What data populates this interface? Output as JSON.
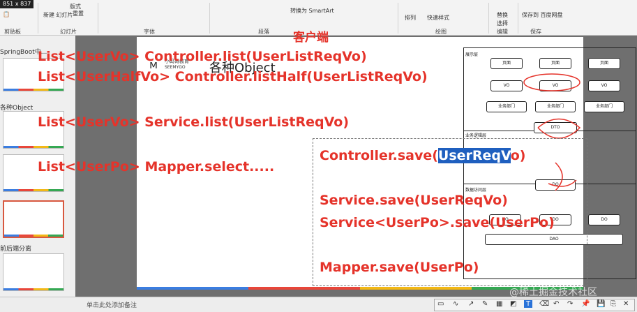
{
  "ribbon": {
    "dimension_readout": "851 x 837",
    "new_slide_label": "新建\n幻灯片",
    "reuse_label": "重置",
    "section_label": "版式",
    "groups": [
      "剪贴板",
      "幻灯片",
      "字体",
      "段落",
      "绘图",
      "编辑",
      "保存"
    ],
    "smartart_label": "转换为 SmartArt",
    "arrange_label": "排列",
    "quickstyle_label": "快速样式",
    "replace_label": "替换",
    "select_label": "选择",
    "save_cloud_label": "保存到\n百度网盘"
  },
  "thumbnails": {
    "section1": "SpringBoot中...",
    "section2": "各种Object",
    "section3": "前后端分离"
  },
  "slide": {
    "client_title": "客户端",
    "logo_name": "小码哥教育",
    "logo_sub": "SEEMYGO",
    "heading": "各种Object",
    "lines": [
      "List<UserVo> Controller.list(UserListReqVo)",
      "List<UserHalfVo> Controller.listHalf(UserListReqVo)",
      "List<UserVo> Service.list(UserListReqVo)",
      "List<UserPo> Mapper.select....."
    ],
    "save_lines": {
      "controller_prefix": "Controller.save(",
      "controller_highlight": "UserReqV",
      "controller_suffix": "o)",
      "service1": "Service.save(UserReqVo)",
      "service2": "Service<UserPo>.save(UserPo)",
      "mapper": "Mapper.save(UserPo)"
    },
    "diagram": {
      "layer1": "展示层",
      "layer2": "业务逻辑层",
      "layer3": "数据访问层",
      "page": "页面",
      "vo": "VO",
      "biz": "业务部门",
      "dto": "DTO",
      "do_label": "DO",
      "dao": "DAO"
    }
  },
  "notes": {
    "placeholder": "单击此处添加备注"
  },
  "watermark": "@稀土掘金技术社区"
}
